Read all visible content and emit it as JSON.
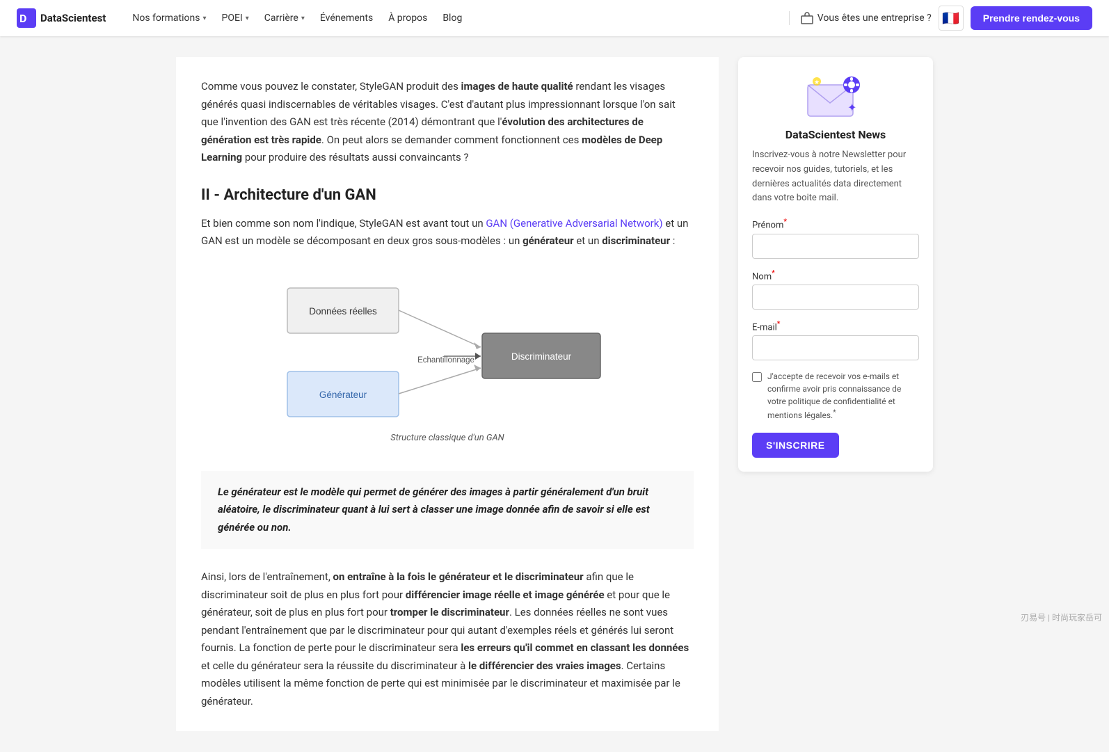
{
  "navbar": {
    "logo_text": "DataScientest",
    "links": [
      {
        "label": "Nos formations",
        "has_dropdown": true
      },
      {
        "label": "POEI",
        "has_dropdown": true
      },
      {
        "label": "Carrière",
        "has_dropdown": true
      },
      {
        "label": "Événements",
        "has_dropdown": false
      },
      {
        "label": "À propos",
        "has_dropdown": false
      },
      {
        "label": "Blog",
        "has_dropdown": false
      }
    ],
    "enterprise_label": "Vous êtes une entreprise ?",
    "flag": "🇫🇷",
    "cta_label": "Prendre rendez-vous"
  },
  "main": {
    "intro_text_1": "Comme vous pouvez le constater, StyleGAN produit des ",
    "intro_bold_1": "images de haute qualité",
    "intro_text_2": " rendant les visages générés quasi indiscernables de véritables visages. C'est d'autant plus impressionnant lorsque l'on sait que l'invention des GAN est très récente (2014) démontrant que l'",
    "intro_bold_2": "évolution des architectures de génération est très rapide",
    "intro_text_3": ". On peut alors se demander comment fonctionnent ces ",
    "intro_bold_3": "modèles de Deep Learning",
    "intro_text_4": " pour produire des résultats aussi convaincants ?",
    "section_heading": "II - Architecture d'un GAN",
    "section_text_1": "Et bien comme son nom l'indique, StyleGAN est avant tout un ",
    "section_link": "GAN (Generative Adversarial Network)",
    "section_text_2": " et un GAN est un modèle se décomposant en deux gros sous-modèles : un ",
    "section_bold_1": "générateur",
    "section_text_3": " et un ",
    "section_bold_2": "discriminateur",
    "section_text_4": " :",
    "diagram": {
      "caption": "Structure classique d'un GAN",
      "box_donnees": "Données réelles",
      "box_generateur": "Générateur",
      "box_discriminateur": "Discriminateur",
      "label_echantillonnage": "Echantillonnage"
    },
    "blockquote": "Le générateur est le modèle qui permet de générer des images à partir généralement d'un bruit aléatoire, le discriminateur quant à lui sert à classer une image donnée afin de savoir si elle est générée ou non.",
    "bottom_text_1": "Ainsi, lors de l'entraînement, ",
    "bottom_bold_1": "on entraîne à la fois le générateur et le discriminateur",
    "bottom_text_2": " afin que le discriminateur soit de plus en plus fort pour ",
    "bottom_bold_2": "différencier image réelle et image générée",
    "bottom_text_3": " et pour que le générateur, soit de plus en plus fort pour ",
    "bottom_bold_3": "tromper le discriminateur",
    "bottom_text_4": ". Les données réelles ne sont vues pendant l'entraînement que par le discriminateur pour qui autant d'exemples réels et générés lui seront fournis. La fonction de perte pour le discriminateur sera ",
    "bottom_bold_4": "les erreurs qu'il commet en classant les données",
    "bottom_text_5": " et celle du générateur sera la réussite du discriminateur à ",
    "bottom_bold_5": "le différencier des vraies images",
    "bottom_text_6": ". Certains modèles utilisent la même fonction de perte qui est minimisée par le discriminateur et maximisée par le générateur."
  },
  "sidebar": {
    "title": "DataScientest News",
    "description": "Inscrivez-vous à notre Newsletter pour recevoir nos guides, tutoriels, et les dernières actualités data directement dans votre boite mail.",
    "form": {
      "prenom_label": "Prénom",
      "prenom_required": true,
      "nom_label": "Nom",
      "nom_required": true,
      "email_label": "E-mail",
      "email_required": true,
      "checkbox_text": "J'accepte de recevoir vos e-mails et confirme avoir pris connaissance de votre politique de confidentialité et mentions légales.",
      "checkbox_required": true,
      "submit_label": "S'INSCRIRE"
    }
  },
  "watermark": "刃易号 | 时尚玩家岳可"
}
